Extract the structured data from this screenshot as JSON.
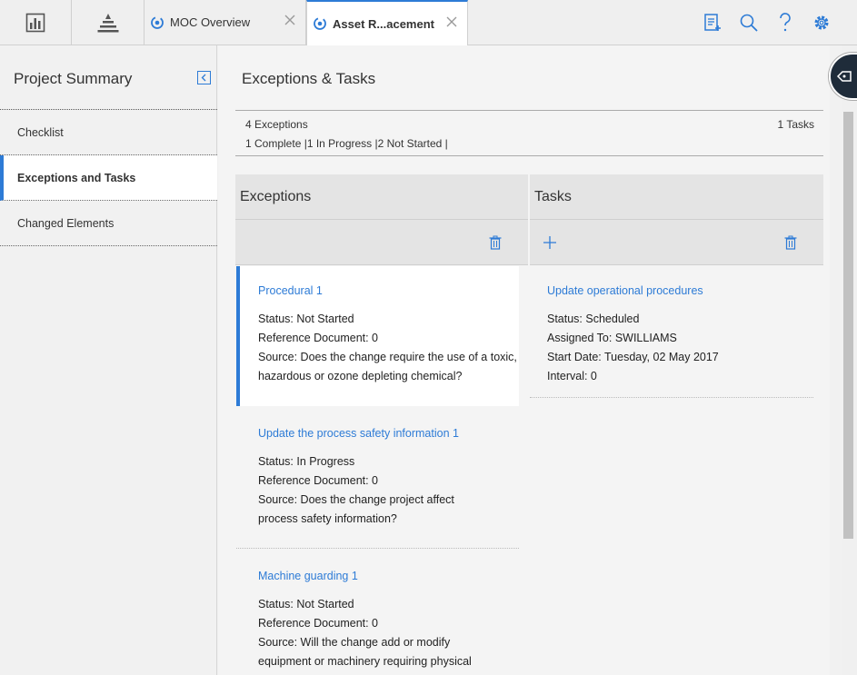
{
  "tabs": [
    {
      "label": "MOC Overview",
      "active": false
    },
    {
      "label": "Asset R...acement",
      "active": true
    }
  ],
  "sidebar": {
    "title": "Project Summary",
    "items": [
      {
        "label": "Checklist",
        "active": false
      },
      {
        "label": "Exceptions and Tasks",
        "active": true
      },
      {
        "label": "Changed Elements",
        "active": false
      }
    ]
  },
  "main": {
    "title": "Exceptions & Tasks",
    "summary": {
      "exceptions_count": "4 Exceptions",
      "exceptions_status": "1 Complete |1 In Progress |2 Not Started |",
      "tasks_count": "1 Tasks"
    },
    "exceptions": {
      "heading": "Exceptions",
      "items": [
        {
          "title": "Procedural 1",
          "status": "Status: Not Started",
          "reference": "Reference Document: 0",
          "source": "Source: Does the change require the use of a toxic, hazardous or ozone depleting chemical?"
        },
        {
          "title": "Update the process safety information 1",
          "status": "Status: In Progress",
          "reference": "Reference Document: 0",
          "source": "Source: Does the change project affect process safety information?"
        },
        {
          "title": "Machine guarding 1",
          "status": "Status: Not Started",
          "reference": "Reference Document: 0",
          "source": "Source: Will the change add or modify equipment or machinery requiring physical guarding?"
        }
      ]
    },
    "tasks": {
      "heading": "Tasks",
      "items": [
        {
          "title": "Update operational procedures",
          "status": "Status: Scheduled",
          "assigned": "Assigned To: SWILLIAMS",
          "start": "Start Date: Tuesday, 02 May 2017",
          "interval": "Interval: 0"
        }
      ]
    }
  },
  "colors": {
    "accent": "#2d7bd6",
    "panel": "#e4e4e4"
  }
}
